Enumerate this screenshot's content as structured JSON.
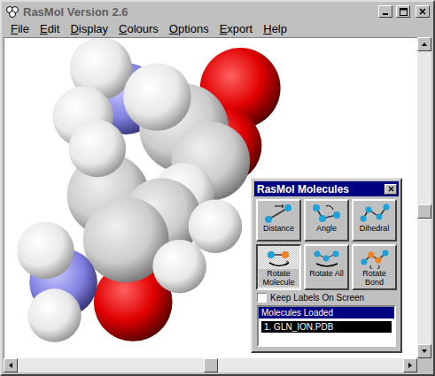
{
  "window": {
    "title": "RasMol Version 2.6"
  },
  "menu": [
    {
      "label": "File"
    },
    {
      "label": "Edit"
    },
    {
      "label": "Display"
    },
    {
      "label": "Colours"
    },
    {
      "label": "Options"
    },
    {
      "label": "Export"
    },
    {
      "label": "Help"
    }
  ],
  "scroll": {
    "vertical": 0.55,
    "horizontal": 0.5
  },
  "palette": {
    "title": "RasMol Molecules",
    "tools": [
      {
        "label": "Distance",
        "kind": "distance",
        "selected": false
      },
      {
        "label": "Angle",
        "kind": "angle",
        "selected": false
      },
      {
        "label": "Dihedral",
        "kind": "dihedral",
        "selected": false
      },
      {
        "label": "Rotate Molecule",
        "kind": "rotate-molecule",
        "selected": true
      },
      {
        "label": "Rotate All",
        "kind": "rotate-all",
        "selected": false
      },
      {
        "label": "Rotate Bond",
        "kind": "rotate-bond",
        "selected": false
      }
    ],
    "checkbox": {
      "label": "Keep Labels On Screen",
      "checked": false
    },
    "molecules": {
      "header": "Molecules Loaded",
      "items": [
        {
          "label": "1. GLN_ION.PDB",
          "selected": true
        }
      ]
    }
  }
}
